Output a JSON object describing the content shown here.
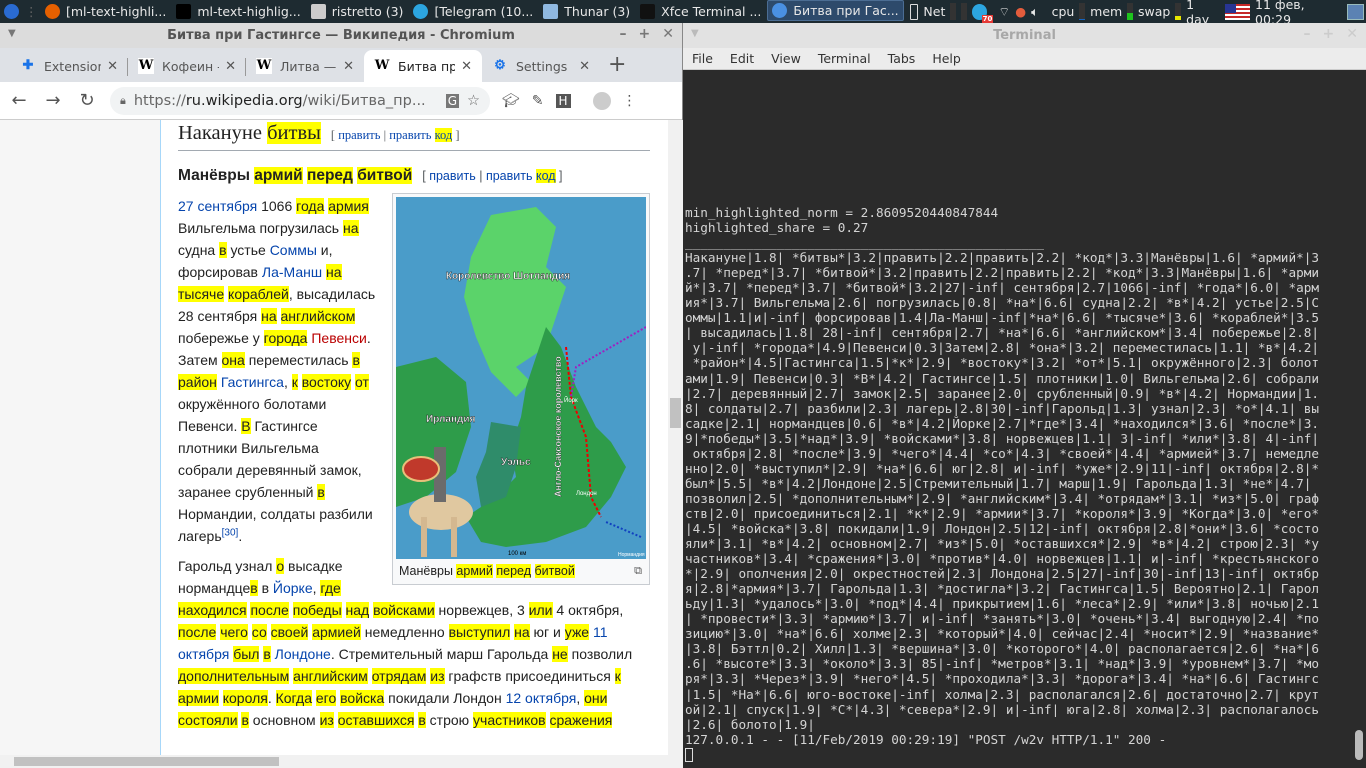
{
  "taskbar": {
    "items": [
      {
        "label": "[ml-text-highli...",
        "icon": "firefox-icon",
        "color": "#e66000"
      },
      {
        "label": "ml-text-highlig...",
        "icon": "pycharm-icon",
        "color": "#000000"
      },
      {
        "label": "ristretto (3)",
        "icon": "image-viewer-icon",
        "color": "#cccccc"
      },
      {
        "label": "[Telegram (10...",
        "icon": "telegram-icon",
        "color": "#2ca5e0"
      },
      {
        "label": "Thunar (3)",
        "icon": "folder-icon",
        "color": "#8fb8e0"
      },
      {
        "label": "Xfce Terminal ...",
        "icon": "terminal-icon",
        "color": "#111111"
      },
      {
        "label": "Битва при Гас...",
        "icon": "chromium-icon",
        "color": "#4a90e2"
      }
    ],
    "net_label": "Net",
    "telegram_badge": "70",
    "cpu_label": "cpu",
    "mem_label": "mem",
    "swap_label": "swap",
    "cpu_level": 0.05,
    "mem_level": 0.4,
    "swap_level": 0.25,
    "uptime": "1 day",
    "clock": "11 фев, 00:29"
  },
  "browser": {
    "window_title": "Битва при Гастингсе — Википедия - Chromium",
    "tabs": [
      {
        "label": "Extensions",
        "icon": "puzzle-icon"
      },
      {
        "label": "Кофеин - Википедия",
        "icon": "wikipedia-icon"
      },
      {
        "label": "Литва — Википедия",
        "icon": "wikipedia-icon"
      },
      {
        "label": "Битва при Гастингсе",
        "icon": "wikipedia-icon",
        "active": true
      },
      {
        "label": "Settings",
        "icon": "gear-icon"
      }
    ],
    "url_scheme": "https://",
    "url_host": "ru.wikipedia.org",
    "url_path": "/wiki/Битва_пр...",
    "ext_h_label": "H"
  },
  "article": {
    "h2": [
      {
        "t": "Накануне "
      },
      {
        "t": "битвы",
        "s": "h"
      }
    ],
    "h2_edit": [
      "[ ",
      "править",
      " | ",
      "править",
      " ",
      "код",
      " ]"
    ],
    "h3": [
      {
        "t": "Манёвры "
      },
      {
        "t": "армий",
        "s": "h"
      },
      {
        "t": " "
      },
      {
        "t": "перед",
        "s": "h"
      },
      {
        "t": " "
      },
      {
        "t": "битвой",
        "s": "h"
      }
    ],
    "h3_edit": [
      "[ ",
      "править",
      " | ",
      "править",
      " ",
      "код",
      " ]"
    ],
    "caption": [
      {
        "t": "Манёвры "
      },
      {
        "t": "армий",
        "s": "h"
      },
      {
        "t": " "
      },
      {
        "t": "перед",
        "s": "h"
      },
      {
        "t": " "
      },
      {
        "t": "битвой",
        "s": "h"
      }
    ],
    "map_labels": {
      "scotland": "Королевство Шотландия",
      "ireland": "Ирландия",
      "wales": "Уэльс",
      "anglo_saxon": "Англо-Саксонское королевство",
      "scale": "100 км",
      "york": "Йорк",
      "london": "Лондон",
      "normandy": "Нормандия"
    },
    "paras": [
      [
        {
          "t": "27 сентября",
          "s": "l"
        },
        {
          "t": " 1066 "
        },
        {
          "t": "года",
          "s": "h"
        },
        {
          "t": " "
        },
        {
          "t": "армия",
          "s": "h"
        },
        {
          "t": " Вильгельма погрузилась "
        },
        {
          "t": "на",
          "s": "h"
        },
        {
          "t": " судна "
        },
        {
          "t": "в",
          "s": "h"
        },
        {
          "t": " устье "
        },
        {
          "t": "Соммы",
          "s": "l"
        },
        {
          "t": " и, форсировав "
        },
        {
          "t": "Ла-Манш",
          "s": "l"
        },
        {
          "t": " "
        },
        {
          "t": "на",
          "s": "h"
        },
        {
          "t": " "
        },
        {
          "t": "тысяче",
          "s": "h"
        },
        {
          "t": " "
        },
        {
          "t": "кораблей",
          "s": "h"
        },
        {
          "t": ", высадилась 28 сентября "
        },
        {
          "t": "на",
          "s": "h"
        },
        {
          "t": " "
        },
        {
          "t": "английском",
          "s": "h"
        },
        {
          "t": " побережье у "
        },
        {
          "t": "города",
          "s": "h"
        },
        {
          "t": " "
        },
        {
          "t": "Певенси",
          "s": "r"
        },
        {
          "t": ". Затем "
        },
        {
          "t": "она",
          "s": "h"
        },
        {
          "t": " переместилась "
        },
        {
          "t": "в",
          "s": "h"
        },
        {
          "t": " "
        },
        {
          "t": "район",
          "s": "h"
        },
        {
          "t": " "
        },
        {
          "t": "Гастингса",
          "s": "l"
        },
        {
          "t": ", "
        },
        {
          "t": "к",
          "s": "h"
        },
        {
          "t": " "
        },
        {
          "t": "востоку",
          "s": "h"
        },
        {
          "t": " "
        },
        {
          "t": "от",
          "s": "h"
        },
        {
          "t": " окружённого болотами Певенси. "
        },
        {
          "t": "В",
          "s": "h"
        },
        {
          "t": " Гастингсе плотники Вильгельма собрали деревянный замок, заранее срубленный "
        },
        {
          "t": "в",
          "s": "h"
        },
        {
          "t": " Нормандии, солдаты разбили лагерь"
        },
        {
          "t": "[30]",
          "s": "sup"
        },
        {
          "t": "."
        }
      ],
      [
        {
          "t": "Гарольд узнал "
        },
        {
          "t": "о",
          "s": "h"
        },
        {
          "t": " высадке нормандце"
        },
        {
          "t": "в",
          "s": "h"
        },
        {
          "t": " в "
        },
        {
          "t": "Йорке",
          "s": "l"
        },
        {
          "t": ", "
        },
        {
          "t": "где",
          "s": "h"
        },
        {
          "t": " "
        },
        {
          "t": "находился",
          "s": "h"
        },
        {
          "t": " "
        },
        {
          "t": "после",
          "s": "h"
        },
        {
          "t": " "
        },
        {
          "t": "победы",
          "s": "h"
        },
        {
          "t": " "
        },
        {
          "t": "над",
          "s": "h"
        },
        {
          "t": " "
        },
        {
          "t": "войсками",
          "s": "h"
        },
        {
          "t": " норвежцев, 3 "
        },
        {
          "t": "или",
          "s": "h"
        },
        {
          "t": " 4 октября, "
        },
        {
          "t": "после",
          "s": "h"
        },
        {
          "t": " "
        },
        {
          "t": "чего",
          "s": "h"
        },
        {
          "t": " "
        },
        {
          "t": "со",
          "s": "h"
        },
        {
          "t": " "
        },
        {
          "t": "своей",
          "s": "h"
        },
        {
          "t": " "
        },
        {
          "t": "армией",
          "s": "h"
        },
        {
          "t": " немедленно "
        },
        {
          "t": "выступил",
          "s": "h"
        },
        {
          "t": " "
        },
        {
          "t": "на",
          "s": "h"
        },
        {
          "t": " юг и "
        },
        {
          "t": "уже",
          "s": "h"
        },
        {
          "t": " "
        },
        {
          "t": "11 октября",
          "s": "l"
        },
        {
          "t": " "
        },
        {
          "t": "был",
          "s": "h"
        },
        {
          "t": " "
        },
        {
          "t": "в",
          "s": "h"
        },
        {
          "t": " "
        },
        {
          "t": "Лондоне",
          "s": "l"
        },
        {
          "t": ". Стремительный марш Гарольда "
        },
        {
          "t": "не",
          "s": "h"
        },
        {
          "t": " позволил "
        },
        {
          "t": "дополнительным",
          "s": "h"
        },
        {
          "t": " "
        },
        {
          "t": "английским",
          "s": "h"
        },
        {
          "t": " "
        },
        {
          "t": "отрядам",
          "s": "h"
        },
        {
          "t": " "
        },
        {
          "t": "из",
          "s": "h"
        },
        {
          "t": " графств присоединиться "
        },
        {
          "t": "к",
          "s": "h"
        },
        {
          "t": " "
        },
        {
          "t": "армии",
          "s": "h"
        },
        {
          "t": " "
        },
        {
          "t": "короля",
          "s": "h"
        },
        {
          "t": ". "
        },
        {
          "t": "Когда",
          "s": "h"
        },
        {
          "t": " "
        },
        {
          "t": "его",
          "s": "h"
        },
        {
          "t": " "
        },
        {
          "t": "войска",
          "s": "h"
        },
        {
          "t": " покидали Лондон "
        },
        {
          "t": "12 октября",
          "s": "l"
        },
        {
          "t": ", "
        },
        {
          "t": "они",
          "s": "h"
        },
        {
          "t": " "
        },
        {
          "t": "состояли",
          "s": "h"
        },
        {
          "t": " "
        },
        {
          "t": "в",
          "s": "h"
        },
        {
          "t": " основном "
        },
        {
          "t": "из",
          "s": "h"
        },
        {
          "t": " "
        },
        {
          "t": "оставшихся",
          "s": "h"
        },
        {
          "t": " "
        },
        {
          "t": "в",
          "s": "h"
        },
        {
          "t": " строю "
        },
        {
          "t": "участников",
          "s": "h"
        },
        {
          "t": " "
        },
        {
          "t": "сражения",
          "s": "h"
        }
      ]
    ]
  },
  "terminal": {
    "window_title": "Terminal",
    "menu": [
      "File",
      "Edit",
      "View",
      "Terminal",
      "Tabs",
      "Help"
    ],
    "lines": [
      "min_highlighted_norm = 2.8609520440847844",
      "highlighted_share = 0.27",
      "_______________________________________________",
      "Накануне|1.8| *битвы*|3.2|править|2.2|править|2.2| *код*|3.3|Манёвры|1.6| *армий*|3",
      ".7| *перед*|3.7| *битвой*|3.2|править|2.2|править|2.2| *код*|3.3|Манёвры|1.6| *арми",
      "й*|3.7| *перед*|3.7| *битвой*|3.2|27|-inf| сентября|2.7|1066|-inf| *года*|6.0| *арм",
      "ия*|3.7| Вильгельма|2.6| погрузилась|0.8| *на*|6.6| судна|2.2| *в*|4.2| устье|2.5|С",
      "оммы|1.1|и|-inf| форсировав|1.4|Ла-Манш|-inf|*на*|6.6| *тысяче*|3.6| *кораблей*|3.5",
      "| высадилась|1.8| 28|-inf| сентября|2.7| *на*|6.6| *английском*|3.4| побережье|2.8|",
      " у|-inf| *города*|4.9|Певенси|0.3|Затем|2.8| *она*|3.2| переместилась|1.1| *в*|4.2|",
      " *район*|4.5|Гастингса|1.5|*к*|2.9| *востоку*|3.2| *от*|5.1| окружённого|2.3| болот",
      "ами|1.9| Певенси|0.3| *В*|4.2| Гастингсе|1.5| плотники|1.0| Вильгельма|2.6| собрали",
      "|2.7| деревянный|2.7| замок|2.5| заранее|2.0| срубленный|0.9| *в*|4.2| Нормандии|1.",
      "8| солдаты|2.7| разбили|2.3| лагерь|2.8|30|-inf|Гарольд|1.3| узнал|2.3| *о*|4.1| вы",
      "садке|2.1| нормандцев|0.6| *в*|4.2|Йорке|2.7|*где*|3.4| *находился*|3.6| *после*|3.",
      "9|*победы*|3.5|*над*|3.9| *войсками*|3.8| норвежцев|1.1| 3|-inf| *или*|3.8| 4|-inf|",
      " октября|2.8| *после*|3.9| *чего*|4.4| *со*|4.3| *своей*|4.4| *армией*|3.7| немедле",
      "нно|2.0| *выступил*|2.9| *на*|6.6| юг|2.8| и|-inf| *уже*|2.9|11|-inf| октября|2.8|*",
      "был*|5.5| *в*|4.2|Лондоне|2.5|Стремительный|1.7| марш|1.9| Гарольда|1.3| *не*|4.7|",
      "позволил|2.5| *дополнительным*|2.9| *английским*|3.4| *отрядам*|3.1| *из*|5.0| граф",
      "ств|2.0| присоединиться|2.1| *к*|2.9| *армии*|3.7| *короля*|3.9| *Когда*|3.0| *его*",
      "|4.5| *войска*|3.8| покидали|1.9| Лондон|2.5|12|-inf| октября|2.8|*они*|3.6| *состо",
      "яли*|3.1| *в*|4.2| основном|2.7| *из*|5.0| *оставшихся*|2.9| *в*|4.2| строю|2.3| *у",
      "частников*|3.4| *сражения*|3.0| *против*|4.0| норвежцев|1.1| и|-inf| *крестьянского",
      "*|2.9| ополчения|2.0| окрестностей|2.3| Лондона|2.5|27|-inf|30|-inf|13|-inf| октябр",
      "я|2.8|*армия*|3.7| Гарольда|1.3| *достигла*|3.2| Гастингса|1.5| Вероятно|2.1| Гарол",
      "ьду|1.3| *удалось*|3.0| *под*|4.4| прикрытием|1.6| *леса*|2.9| *или*|3.8| ночью|2.1",
      "| *провести*|3.3| *армию*|3.7| и|-inf| *занять*|3.0| *очень*|3.4| выгодную|2.4| *по",
      "зицию*|3.0| *на*|6.6| холме|2.3| *который*|4.0| сейчас|2.4| *носит*|2.9| *название*",
      "|3.8| Бэттл|0.2| Хилл|1.3| *вершина*|3.0| *которого*|4.0| располагается|2.6| *на*|6",
      ".6| *высоте*|3.3| *около*|3.3| 85|-inf| *метров*|3.1| *над*|3.9| *уровнем*|3.7| *мо",
      "ря*|3.3| *Через*|3.9| *него*|4.5| *проходила*|3.3| *дорога*|3.4| *на*|6.6| Гастингс",
      "|1.5| *На*|6.6| юго-востоке|-inf| холма|2.3| располагался|2.6| достаточно|2.7| крут",
      "ой|2.1| спуск|1.9| *С*|4.3| *севера*|2.9| и|-inf| юга|2.8| холма|2.3| располагалось",
      "|2.6| болото|1.9|",
      "127.0.0.1 - - [11/Feb/2019 00:29:19] \"POST /w2v HTTP/1.1\" 200 -"
    ]
  }
}
